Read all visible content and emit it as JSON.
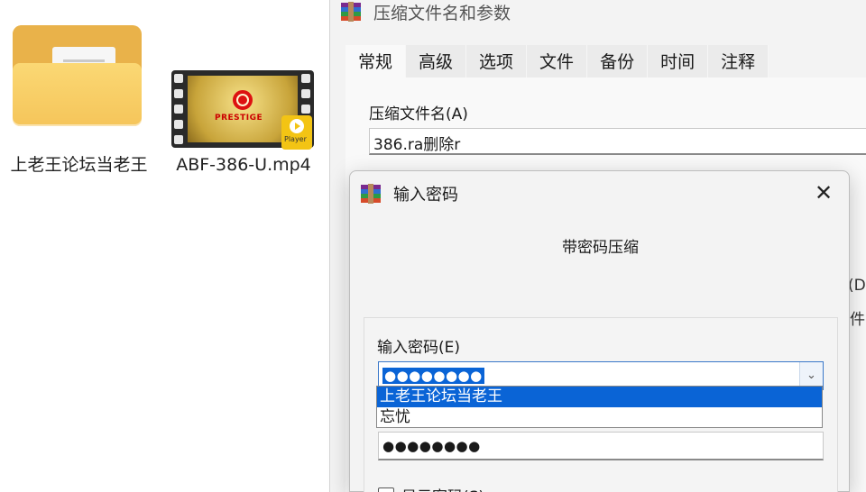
{
  "desktop": {
    "folder": {
      "label": "上老王论坛当老王"
    },
    "video": {
      "label": "ABF-386-U.mp4",
      "thumb_text": "PRESTIGE",
      "badge_text": "Player"
    }
  },
  "archive_dialog": {
    "title": "压缩文件名和参数",
    "tabs": [
      "常规",
      "高级",
      "选项",
      "文件",
      "备份",
      "时间",
      "注释"
    ],
    "archive_name_label": "压缩文件名(A)",
    "archive_name_value": "386.ra删除r",
    "side_text_1": "(D",
    "side_text_2": "件"
  },
  "password_dialog": {
    "title": "输入密码",
    "header": "带密码压缩",
    "password_label": "输入密码(E)",
    "password_value": "●●●●●●●●",
    "dropdown_options": [
      "上老王论坛当老王",
      "忘忧"
    ],
    "confirm_value": "●●●●●●●●",
    "show_password_label": "显示密码(S)"
  },
  "colors": {
    "selection": "#0a64d6",
    "folder": "#f5c55a",
    "player_badge": "#f3c414"
  }
}
